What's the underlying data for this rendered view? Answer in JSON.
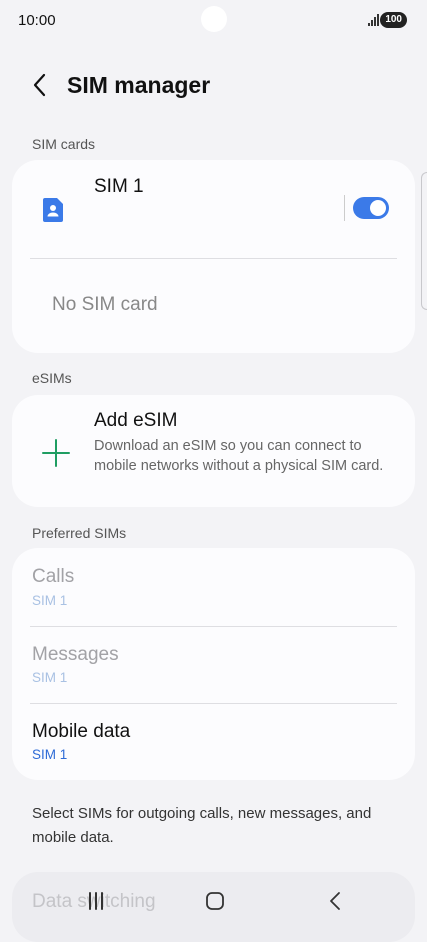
{
  "status": {
    "time": "10:00",
    "battery": "100"
  },
  "header": {
    "title": "SIM manager"
  },
  "sections": {
    "sim_cards": "SIM cards",
    "esims": "eSIMs",
    "preferred": "Preferred SIMs"
  },
  "sim_cards": {
    "sim1": {
      "name": "SIM 1",
      "enabled": true
    },
    "empty_slot": "No SIM card"
  },
  "esim": {
    "title": "Add eSIM",
    "description": "Download an eSIM so you can connect to mobile networks without a physical SIM card."
  },
  "preferred": [
    {
      "title": "Calls",
      "value": "SIM 1",
      "enabled": false
    },
    {
      "title": "Messages",
      "value": "SIM 1",
      "enabled": false
    },
    {
      "title": "Mobile data",
      "value": "SIM 1",
      "enabled": true
    }
  ],
  "footer_note": "Select SIMs for outgoing calls, new messages, and mobile data.",
  "next_item": "Data switching",
  "colors": {
    "accent": "#3b7ae8",
    "plus": "#1f9d62",
    "background": "#f3f3f6",
    "card": "#fcfcfe"
  },
  "icons": {
    "back": "chevron-left",
    "sim": "sim-card",
    "add": "plus",
    "recents": "recents",
    "home": "home",
    "nav_back": "back"
  }
}
